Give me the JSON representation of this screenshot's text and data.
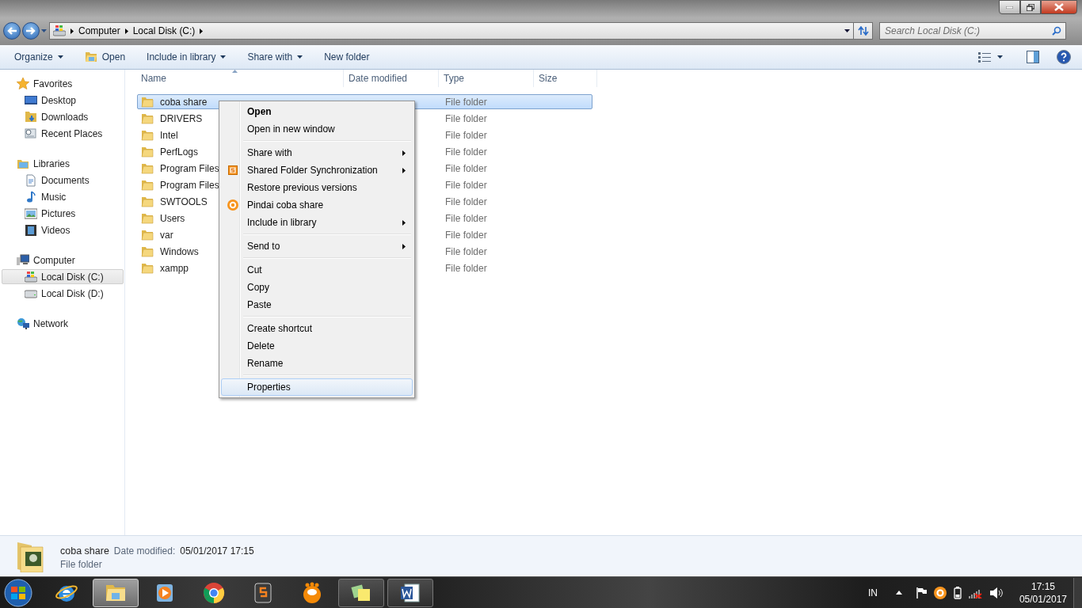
{
  "address_bar": {
    "crumbs": [
      "Computer",
      "Local Disk (C:)"
    ]
  },
  "search": {
    "placeholder": "Search Local Disk (C:)"
  },
  "toolbar": {
    "items": [
      {
        "label": "Organize",
        "kind": "menu"
      },
      {
        "label": "Open",
        "kind": "icon"
      },
      {
        "label": "Include in library",
        "kind": "menu"
      },
      {
        "label": "Share with",
        "kind": "menu"
      },
      {
        "label": "New folder",
        "kind": "plain"
      }
    ]
  },
  "sidebar": {
    "groups": [
      {
        "label": "Favorites",
        "kind": "star",
        "children": [
          {
            "label": "Desktop",
            "kind": "desktop",
            "selected": false
          },
          {
            "label": "Downloads",
            "kind": "downloads",
            "selected": false
          },
          {
            "label": "Recent Places",
            "kind": "recent",
            "selected": false
          }
        ]
      },
      {
        "label": "Libraries",
        "kind": "library",
        "children": [
          {
            "label": "Documents",
            "kind": "document",
            "selected": false
          },
          {
            "label": "Music",
            "kind": "music",
            "selected": false
          },
          {
            "label": "Pictures",
            "kind": "pictures",
            "selected": false
          },
          {
            "label": "Videos",
            "kind": "film",
            "selected": false
          }
        ]
      },
      {
        "label": "Computer",
        "kind": "computer",
        "children": [
          {
            "label": "Local Disk (C:)",
            "kind": "sysdisk",
            "selected": true
          },
          {
            "label": "Local Disk (D:)",
            "kind": "disk",
            "selected": false
          }
        ]
      },
      {
        "label": "Network",
        "kind": "network"
      }
    ]
  },
  "file_list": {
    "columns": [
      {
        "label": "Name",
        "sorted": true
      },
      {
        "label": "Date modified",
        "sorted": false
      },
      {
        "label": "Type",
        "sorted": false
      },
      {
        "label": "Size",
        "sorted": false
      }
    ],
    "rows": [
      {
        "name": "coba share",
        "type": "File folder",
        "selected": true
      },
      {
        "name": "DRIVERS",
        "type": "File folder",
        "selected": false
      },
      {
        "name": "Intel",
        "type": "File folder",
        "selected": false
      },
      {
        "name": "PerfLogs",
        "type": "File folder",
        "selected": false
      },
      {
        "name": "Program Files",
        "type": "File folder",
        "selected": false
      },
      {
        "name": "Program Files",
        "type": "File folder",
        "selected": false
      },
      {
        "name": "SWTOOLS",
        "type": "File folder",
        "selected": false
      },
      {
        "name": "Users",
        "type": "File folder",
        "selected": false
      },
      {
        "name": "var",
        "type": "File folder",
        "selected": false
      },
      {
        "name": "Windows",
        "type": "File folder",
        "selected": false
      },
      {
        "name": "xampp",
        "type": "File folder",
        "selected": false
      }
    ]
  },
  "context_menu": {
    "groups": [
      [
        {
          "label": "Open",
          "default": true,
          "submenu": false,
          "hovered": false,
          "kind": "plain"
        },
        {
          "label": "Open in new window",
          "default": false,
          "submenu": false,
          "hovered": false,
          "kind": "plain"
        }
      ],
      [
        {
          "label": "Share with",
          "default": false,
          "submenu": true,
          "hovered": false,
          "kind": "plain"
        },
        {
          "label": "Shared Folder Synchronization",
          "default": false,
          "submenu": true,
          "hovered": false,
          "kind": "sync"
        },
        {
          "label": "Restore previous versions",
          "default": false,
          "submenu": false,
          "hovered": false,
          "kind": "plain"
        },
        {
          "label": "Pindai coba share",
          "default": false,
          "submenu": false,
          "hovered": false,
          "kind": "scan"
        },
        {
          "label": "Include in library",
          "default": false,
          "submenu": true,
          "hovered": false,
          "kind": "plain"
        }
      ],
      [
        {
          "label": "Send to",
          "default": false,
          "submenu": true,
          "hovered": false,
          "kind": "plain"
        }
      ],
      [
        {
          "label": "Cut",
          "default": false,
          "submenu": false,
          "hovered": false,
          "kind": "plain"
        },
        {
          "label": "Copy",
          "default": false,
          "submenu": false,
          "hovered": false,
          "kind": "plain"
        },
        {
          "label": "Paste",
          "default": false,
          "submenu": false,
          "hovered": false,
          "kind": "plain"
        }
      ],
      [
        {
          "label": "Create shortcut",
          "default": false,
          "submenu": false,
          "hovered": false,
          "kind": "plain"
        },
        {
          "label": "Delete",
          "default": false,
          "submenu": false,
          "hovered": false,
          "kind": "plain"
        },
        {
          "label": "Rename",
          "default": false,
          "submenu": false,
          "hovered": false,
          "kind": "plain"
        }
      ],
      [
        {
          "label": "Properties",
          "default": false,
          "submenu": false,
          "hovered": true,
          "kind": "plain"
        }
      ]
    ]
  },
  "details": {
    "name": "coba share",
    "date_label": "Date modified:",
    "date": "05/01/2017 17:15",
    "type": "File folder"
  },
  "taskbar": {
    "apps": [
      {
        "kind": "browser-e",
        "active": false,
        "running": false
      },
      {
        "kind": "explorer",
        "active": true,
        "running": true
      },
      {
        "kind": "player",
        "active": false,
        "running": false
      },
      {
        "kind": "chrome",
        "active": false,
        "running": false
      },
      {
        "kind": "sublime",
        "active": false,
        "running": false
      },
      {
        "kind": "bubble",
        "active": false,
        "running": false
      },
      {
        "kind": "notes",
        "active": false,
        "running": true
      },
      {
        "kind": "word",
        "active": false,
        "running": true
      }
    ],
    "language": "IN",
    "time": "17:15",
    "date": "05/01/2017"
  }
}
